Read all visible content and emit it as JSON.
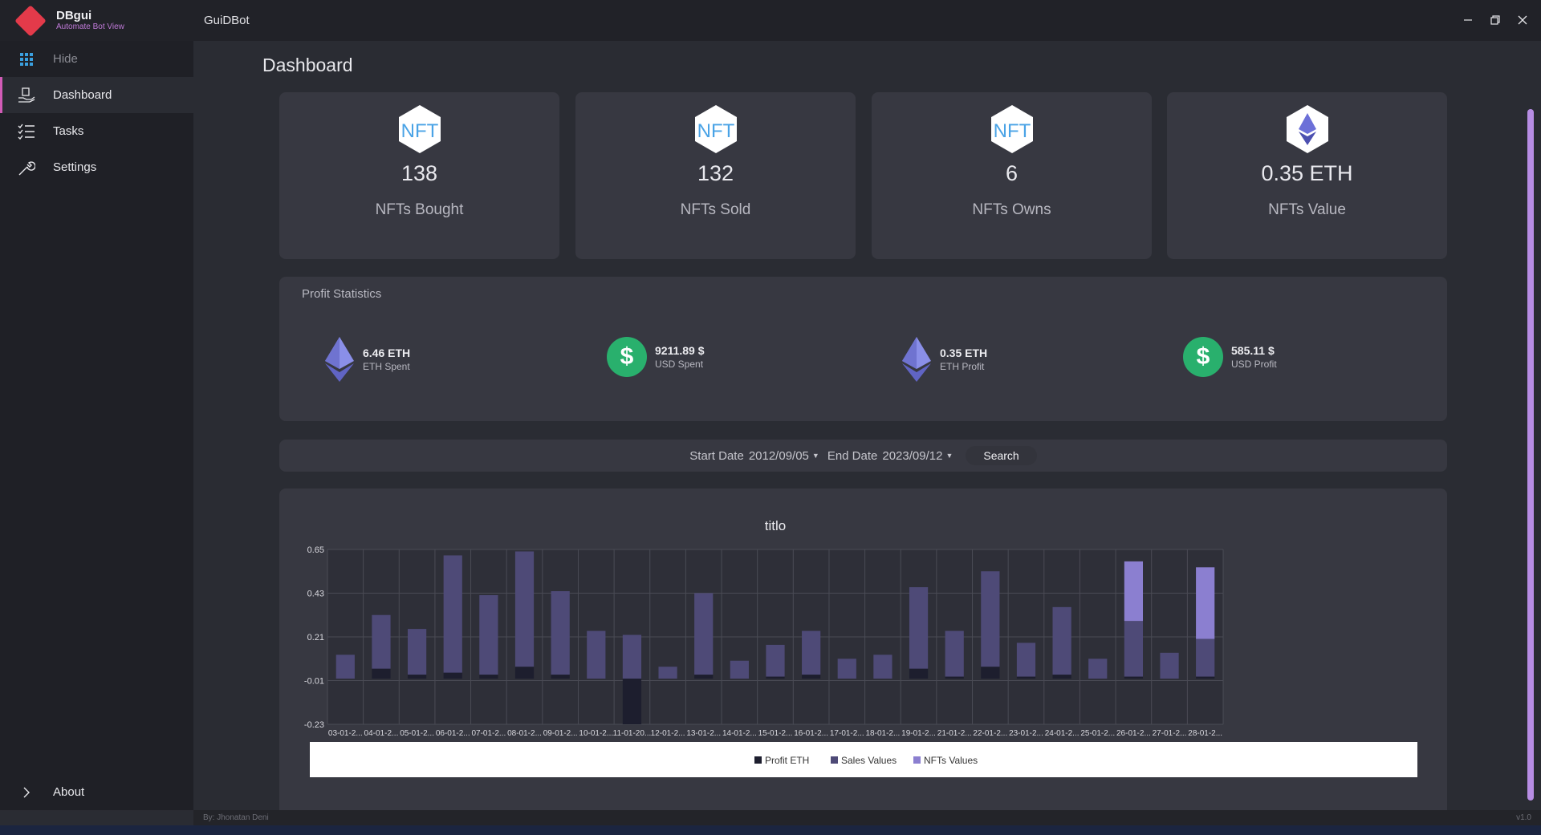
{
  "app": {
    "name": "DBgui",
    "subtitle": "Automate Bot View",
    "window_title": "GuiDBot"
  },
  "colors": {
    "accent": "#d25bb7",
    "brand": "#e33a4a",
    "green": "#29b06d",
    "profit_eth": "#1d1e2e",
    "sales_values": "#4e4a77",
    "nfts_values": "#8b7fd0"
  },
  "sidebar": {
    "items": [
      {
        "label": "Hide",
        "icon": "grid-icon"
      },
      {
        "label": "Dashboard",
        "icon": "dashboard-icon"
      },
      {
        "label": "Tasks",
        "icon": "tasks-icon"
      },
      {
        "label": "Settings",
        "icon": "wrench-icon"
      }
    ],
    "about": "About"
  },
  "page_title": "Dashboard",
  "stats": [
    {
      "value": "138",
      "label": "NFTs Bought",
      "icon": "nft-icon"
    },
    {
      "value": "132",
      "label": "NFTs Sold",
      "icon": "nft-icon"
    },
    {
      "value": "6",
      "label": "NFTs Owns",
      "icon": "nft-icon"
    },
    {
      "value": "0.35 ETH",
      "label": "NFTs Value",
      "icon": "eth-icon"
    }
  ],
  "profit": {
    "title": "Profit Statistics",
    "items": [
      {
        "value": "6.46 ETH",
        "label": "ETH Spent",
        "icon": "eth-icon"
      },
      {
        "value": "9211.89 $",
        "label": "USD Spent",
        "icon": "dollar-icon"
      },
      {
        "value": "0.35 ETH",
        "label": "ETH Profit",
        "icon": "eth-icon"
      },
      {
        "value": "585.11 $",
        "label": "USD Profit",
        "icon": "dollar-icon"
      }
    ]
  },
  "filter": {
    "start_label": "Start Date",
    "start_value": "2012/09/05",
    "end_label": "End Date",
    "end_value": "2023/09/12",
    "search_label": "Search"
  },
  "chart_data": {
    "type": "bar",
    "title": "titlo",
    "categories": [
      "03-01-2...",
      "04-01-2...",
      "05-01-2...",
      "06-01-2...",
      "07-01-2...",
      "08-01-2...",
      "09-01-2...",
      "10-01-2...",
      "11-01-20...",
      "12-01-2...",
      "13-01-2...",
      "14-01-2...",
      "15-01-2...",
      "16-01-2...",
      "17-01-2...",
      "18-01-2...",
      "19-01-2...",
      "21-01-2...",
      "22-01-2...",
      "23-01-2...",
      "24-01-2...",
      "25-01-2...",
      "26-01-2...",
      "27-01-2...",
      "28-01-2..."
    ],
    "series": [
      {
        "name": "Profit ETH",
        "values": [
          0.0,
          0.05,
          0.02,
          0.03,
          0.02,
          0.06,
          0.02,
          0.0,
          -0.23,
          0.0,
          0.02,
          0.0,
          0.01,
          0.02,
          0.0,
          0.0,
          0.05,
          0.01,
          0.06,
          0.01,
          0.02,
          0.0,
          0.01,
          0.0,
          0.01
        ]
      },
      {
        "name": "Sales Values",
        "values": [
          0.12,
          0.27,
          0.23,
          0.59,
          0.4,
          0.58,
          0.42,
          0.24,
          0.22,
          0.06,
          0.41,
          0.09,
          0.16,
          0.22,
          0.1,
          0.12,
          0.41,
          0.23,
          0.48,
          0.17,
          0.34,
          0.1,
          0.28,
          0.13,
          0.19
        ]
      },
      {
        "name": "NFTs Values",
        "values": [
          0,
          0,
          0,
          0,
          0,
          0,
          0,
          0,
          0,
          0,
          0,
          0,
          0,
          0,
          0,
          0,
          0,
          0,
          0,
          0,
          0,
          0,
          0.3,
          0,
          0.36
        ]
      }
    ],
    "yticks": [
      "0.65",
      "0.43",
      "0.21",
      "-0.01",
      "-0.23"
    ],
    "ylim": [
      -0.23,
      0.65
    ],
    "grid": true,
    "legend": "bottom"
  },
  "statusbar": {
    "left": "By: Jhonatan Deni",
    "right": "v1.0"
  }
}
